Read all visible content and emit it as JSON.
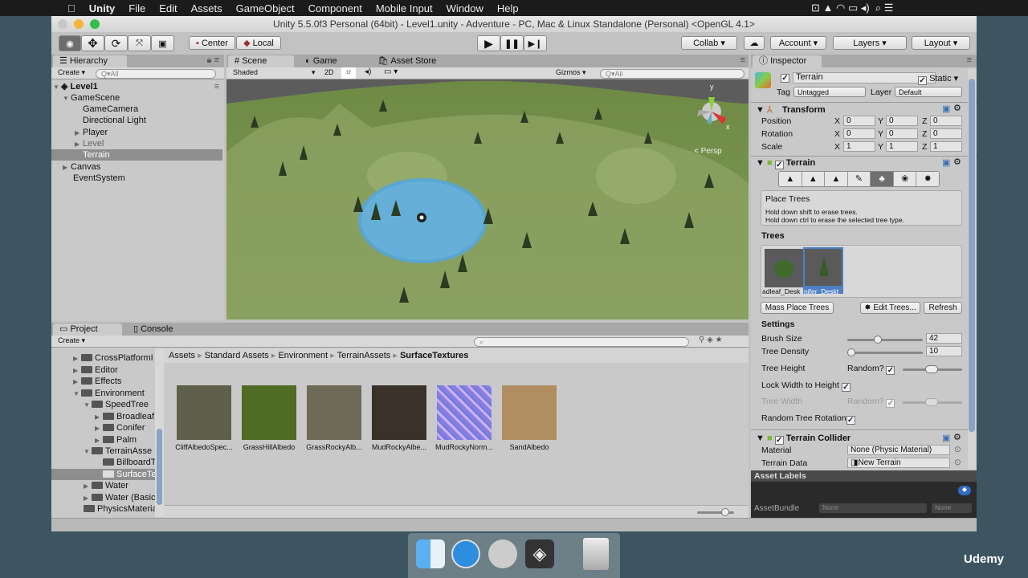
{
  "menubar": {
    "app": "Unity",
    "items": [
      "File",
      "Edit",
      "Assets",
      "GameObject",
      "Component",
      "Mobile Input",
      "Window",
      "Help"
    ]
  },
  "window": {
    "title": "Unity 5.5.0f3 Personal (64bit) - Level1.unity - Adventure - PC, Mac & Linux Standalone (Personal) <OpenGL 4.1>"
  },
  "toolbar": {
    "tools": [
      "view-tool",
      "move-tool",
      "rotate-tool",
      "scale-tool",
      "rect-tool"
    ],
    "pivot": "Center",
    "space": "Local",
    "collab": "Collab ▾",
    "account": "Account ▾",
    "layers": "Layers ▾",
    "layout": "Layout ▾"
  },
  "hierarchy": {
    "tab": "Hierarchy",
    "create": "Create ▾",
    "search_placeholder": "Q▾All",
    "scene": "Level1",
    "items": [
      {
        "label": "GameScene",
        "expanded": true
      },
      {
        "label": "GameCamera"
      },
      {
        "label": "Directional Light"
      },
      {
        "label": "Player",
        "collapsed": true
      },
      {
        "label": "Level",
        "collapsed": true,
        "dim": true
      },
      {
        "label": "Terrain",
        "selected": true
      },
      {
        "label": "Canvas",
        "collapsed": true
      },
      {
        "label": "EventSystem"
      }
    ]
  },
  "scene": {
    "tabs": [
      "Scene",
      "Game",
      "Asset Store"
    ],
    "shading": "Shaded",
    "mode_2d": "2D",
    "gizmos": "Gizmos ▾",
    "search_placeholder": "Q▾All",
    "persp": "< Persp",
    "axis_y": "y",
    "axis_x": "x"
  },
  "project": {
    "tabs": [
      "Project",
      "Console"
    ],
    "create": "Create ▾",
    "tree": [
      {
        "label": "CrossPlatformI"
      },
      {
        "label": "Editor"
      },
      {
        "label": "Effects"
      },
      {
        "label": "Environment"
      },
      {
        "label": "SpeedTree"
      },
      {
        "label": "Broadleaf"
      },
      {
        "label": "Conifer"
      },
      {
        "label": "Palm"
      },
      {
        "label": "TerrainAsse"
      },
      {
        "label": "BillboardT"
      },
      {
        "label": "SurfaceTe",
        "selected": true
      },
      {
        "label": "Water"
      },
      {
        "label": "Water (Basic)"
      },
      {
        "label": "PhysicsMateria"
      }
    ],
    "breadcrumb": [
      "Assets",
      "Standard Assets",
      "Environment",
      "TerrainAssets",
      "SurfaceTextures"
    ],
    "assets": [
      {
        "label": "CliffAlbedoSpec...",
        "color": "#5e604c"
      },
      {
        "label": "GrassHillAlbedo",
        "color": "#4f6b24"
      },
      {
        "label": "GrassRockyAlb...",
        "color": "#6e6a58"
      },
      {
        "label": "MudRockyAlbe...",
        "color": "#3a3128"
      },
      {
        "label": "MudRockyNorm...",
        "color": "#8a7de0"
      },
      {
        "label": "SandAlbedo",
        "color": "#b08e62"
      }
    ]
  },
  "inspector": {
    "tab": "Inspector",
    "name": "Terrain",
    "static": "Static",
    "tag_label": "Tag",
    "tag": "Untagged",
    "layer_label": "Layer",
    "layer": "Default",
    "transform": {
      "title": "Transform",
      "rows": [
        {
          "label": "Position",
          "x": "0",
          "y": "0",
          "z": "0"
        },
        {
          "label": "Rotation",
          "x": "0",
          "y": "0",
          "z": "0"
        },
        {
          "label": "Scale",
          "x": "1",
          "y": "1",
          "z": "1"
        }
      ]
    },
    "terrain": {
      "title": "Terrain",
      "tool_title": "Place Trees",
      "help1": "Hold down shift to erase trees.",
      "help2": "Hold down ctrl to erase the selected tree type.",
      "trees_label": "Trees",
      "trees": [
        "adleaf_Desk",
        "nifer_Deskt"
      ],
      "mass_place": "Mass Place Trees",
      "edit_trees": "✸ Edit Trees...",
      "refresh": "Refresh",
      "settings": "Settings",
      "brush_size_label": "Brush Size",
      "brush_size": "42",
      "density_label": "Tree Density",
      "density": "10",
      "height_label": "Tree Height",
      "random": "Random?",
      "lock_label": "Lock Width to Height",
      "width_label": "Tree Width",
      "rotation_label": "Random Tree Rotation"
    },
    "collider": {
      "title": "Terrain Collider",
      "material_label": "Material",
      "material": "None (Physic Material)",
      "data_label": "Terrain Data",
      "data": "New Terrain"
    },
    "asset_labels": "Asset Labels",
    "asset_bundle": "AssetBundle",
    "bundle_value": "None",
    "bundle_variant": "None"
  },
  "branding": "Udemy"
}
